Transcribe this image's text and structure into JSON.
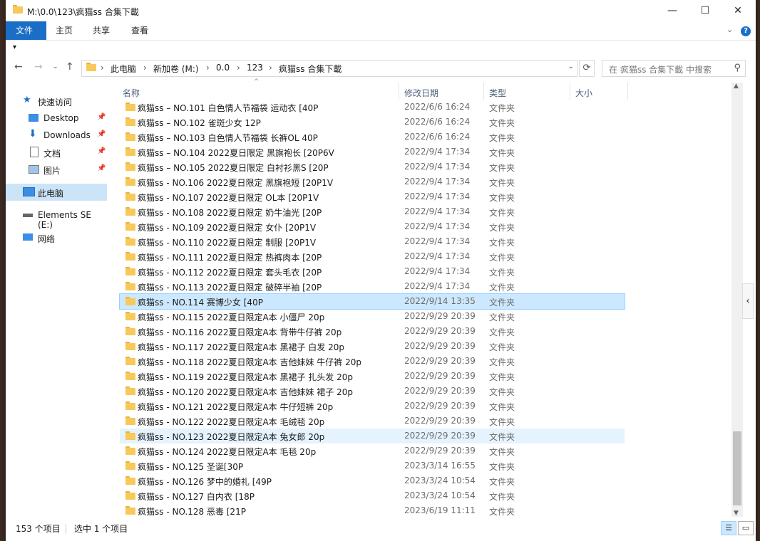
{
  "window": {
    "title": "M:\\0.0\\123\\疯猫ss 合集下載"
  },
  "ribbon": {
    "tabs": [
      "文件",
      "主页",
      "共享",
      "查看"
    ]
  },
  "address": {
    "crumbs": [
      "此电脑",
      "新加卷 (M:)",
      "0.0",
      "123",
      "疯猫ss 合集下載"
    ]
  },
  "search": {
    "placeholder": "在 疯猫ss 合集下載 中搜索"
  },
  "nav": {
    "quick_access": "快速访问",
    "desktop": "Desktop",
    "downloads": "Downloads",
    "documents": "文档",
    "pictures": "图片",
    "this_pc": "此电脑",
    "elements": "Elements SE (E:)",
    "network": "网络"
  },
  "columns": {
    "name": "名称",
    "date": "修改日期",
    "type": "类型",
    "size": "大小"
  },
  "files": [
    {
      "name": "疯猫ss – NO.101 白色情人节福袋 运动衣 [40P",
      "date": "2022/6/6 16:24",
      "type": "文件夹"
    },
    {
      "name": "疯猫ss – NO.102 雀斑少女 12P",
      "date": "2022/6/6 16:24",
      "type": "文件夹"
    },
    {
      "name": "疯猫ss – NO.103 白色情人节福袋 长裤OL  40P",
      "date": "2022/6/6 16:24",
      "type": "文件夹"
    },
    {
      "name": "疯猫ss – NO.104 2022夏日限定 黑旗袍长 [20P6V",
      "date": "2022/9/4 17:34",
      "type": "文件夹"
    },
    {
      "name": "疯猫ss – NO.105 2022夏日限定 白衬衫黑S [20P",
      "date": "2022/9/4 17:34",
      "type": "文件夹"
    },
    {
      "name": "疯猫ss - NO.106 2022夏日限定 黑旗袍短 [20P1V",
      "date": "2022/9/4 17:34",
      "type": "文件夹"
    },
    {
      "name": "疯猫ss - NO.107 2022夏日限定 OL本 [20P1V",
      "date": "2022/9/4 17:34",
      "type": "文件夹"
    },
    {
      "name": "疯猫ss - NO.108 2022夏日限定 奶牛油光 [20P",
      "date": "2022/9/4 17:34",
      "type": "文件夹"
    },
    {
      "name": "疯猫ss - NO.109 2022夏日限定 女仆 [20P1V",
      "date": "2022/9/4 17:34",
      "type": "文件夹"
    },
    {
      "name": "疯猫ss - NO.110 2022夏日限定 制服 [20P1V",
      "date": "2022/9/4 17:34",
      "type": "文件夹"
    },
    {
      "name": "疯猫ss - NO.111 2022夏日限定 热裤肉本 [20P",
      "date": "2022/9/4 17:34",
      "type": "文件夹"
    },
    {
      "name": "疯猫ss - NO.112 2022夏日限定 套头毛衣 [20P",
      "date": "2022/9/4 17:34",
      "type": "文件夹"
    },
    {
      "name": "疯猫ss - NO.113 2022夏日限定 破碎半袖 [20P",
      "date": "2022/9/4 17:34",
      "type": "文件夹"
    },
    {
      "name": "疯猫ss - NO.114 赛博少女 [40P",
      "date": "2022/9/14 13:35",
      "type": "文件夹",
      "state": "selected"
    },
    {
      "name": "疯猫ss - NO.115 2022夏日限定A本 小僵尸 20p",
      "date": "2022/9/29 20:39",
      "type": "文件夹"
    },
    {
      "name": "疯猫ss - NO.116 2022夏日限定A本 背带牛仔裤 20p",
      "date": "2022/9/29 20:39",
      "type": "文件夹"
    },
    {
      "name": "疯猫ss - NO.117 2022夏日限定A本 黑裙子 白发 20p",
      "date": "2022/9/29 20:39",
      "type": "文件夹"
    },
    {
      "name": "疯猫ss - NO.118 2022夏日限定A本 吉他妹妹 牛仔裤 20p",
      "date": "2022/9/29 20:39",
      "type": "文件夹"
    },
    {
      "name": "疯猫ss - NO.119 2022夏日限定A本 黑裙子 扎头发 20p",
      "date": "2022/9/29 20:39",
      "type": "文件夹"
    },
    {
      "name": "疯猫ss - NO.120 2022夏日限定A本 吉他妹妹 裙子 20p",
      "date": "2022/9/29 20:39",
      "type": "文件夹"
    },
    {
      "name": "疯猫ss - NO.121 2022夏日限定A本 牛仔短裤 20p",
      "date": "2022/9/29 20:39",
      "type": "文件夹"
    },
    {
      "name": "疯猫ss - NO.122 2022夏日限定A本 毛绒毯 20p",
      "date": "2022/9/29 20:39",
      "type": "文件夹"
    },
    {
      "name": "疯猫ss - NO.123 2022夏日限定A本 兔女郎 20p",
      "date": "2022/9/29 20:39",
      "type": "文件夹",
      "state": "hover"
    },
    {
      "name": "疯猫ss - NO.124 2022夏日限定A本 毛毯 20p",
      "date": "2022/9/29 20:39",
      "type": "文件夹"
    },
    {
      "name": "疯猫ss - NO.125 圣诞[30P",
      "date": "2023/3/14 16:55",
      "type": "文件夹"
    },
    {
      "name": "疯猫ss - NO.126 梦中的婚礼 [49P",
      "date": "2023/3/24 10:54",
      "type": "文件夹"
    },
    {
      "name": "疯猫ss - NO.127 白内衣 [18P",
      "date": "2023/3/24 10:54",
      "type": "文件夹"
    },
    {
      "name": "疯猫ss - NO.128 恶毒 [21P",
      "date": "2023/6/19 11:11",
      "type": "文件夹"
    }
  ],
  "status": {
    "count": "153 个项目",
    "selection": "选中 1 个项目"
  }
}
